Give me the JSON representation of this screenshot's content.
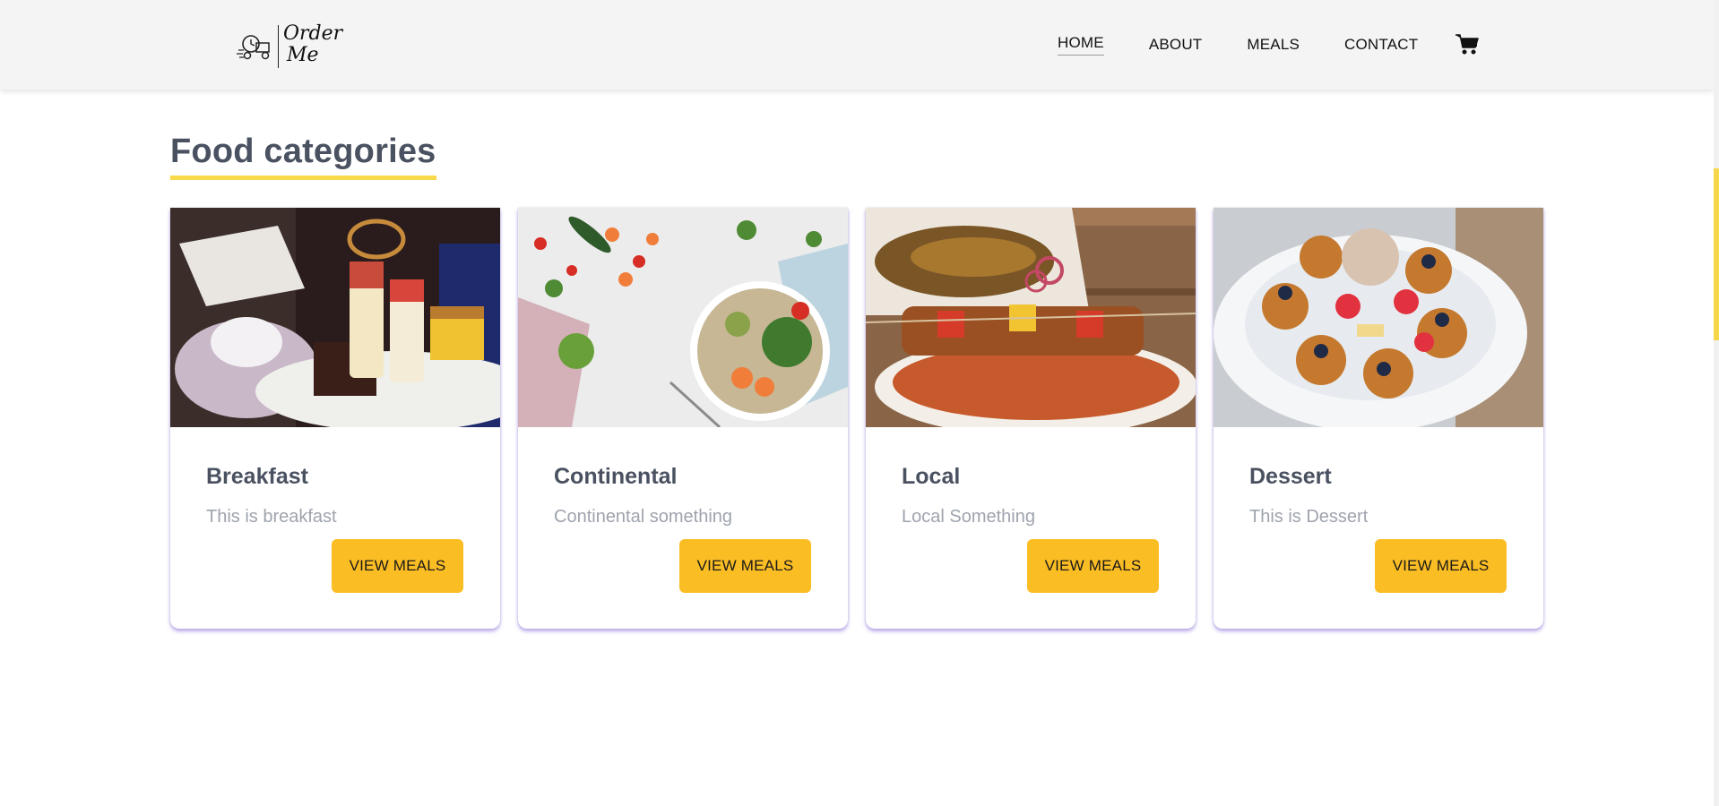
{
  "brand": {
    "name_line1": "Order",
    "name_line2": "Me",
    "logo_icon": "delivery-scooter-icon"
  },
  "nav": {
    "items": [
      {
        "label": "HOME",
        "active": true
      },
      {
        "label": "ABOUT",
        "active": false
      },
      {
        "label": "MEALS",
        "active": false
      },
      {
        "label": "CONTACT",
        "active": false
      }
    ],
    "cart_icon": "shopping-cart-icon"
  },
  "page": {
    "title": "Food categories"
  },
  "categories": [
    {
      "title": "Breakfast",
      "description": "This is breakfast",
      "button": "VIEW MEALS",
      "image": "breakfast-pastries-image"
    },
    {
      "title": "Continental",
      "description": "Continental something",
      "button": "VIEW MEALS",
      "image": "continental-salad-bowl-image"
    },
    {
      "title": "Local",
      "description": "Local Something",
      "button": "VIEW MEALS",
      "image": "jollof-rice-kebab-fish-image"
    },
    {
      "title": "Dessert",
      "description": "This is Dessert",
      "button": "VIEW MEALS",
      "image": "waffle-dessert-image"
    }
  ],
  "colors": {
    "accent": "#fbbd24",
    "title_underline": "#f7d94a",
    "heading": "#4a5160",
    "muted": "#9ea3ad",
    "header_bg": "#f4f4f4",
    "card_shadow": "#8466dc"
  }
}
